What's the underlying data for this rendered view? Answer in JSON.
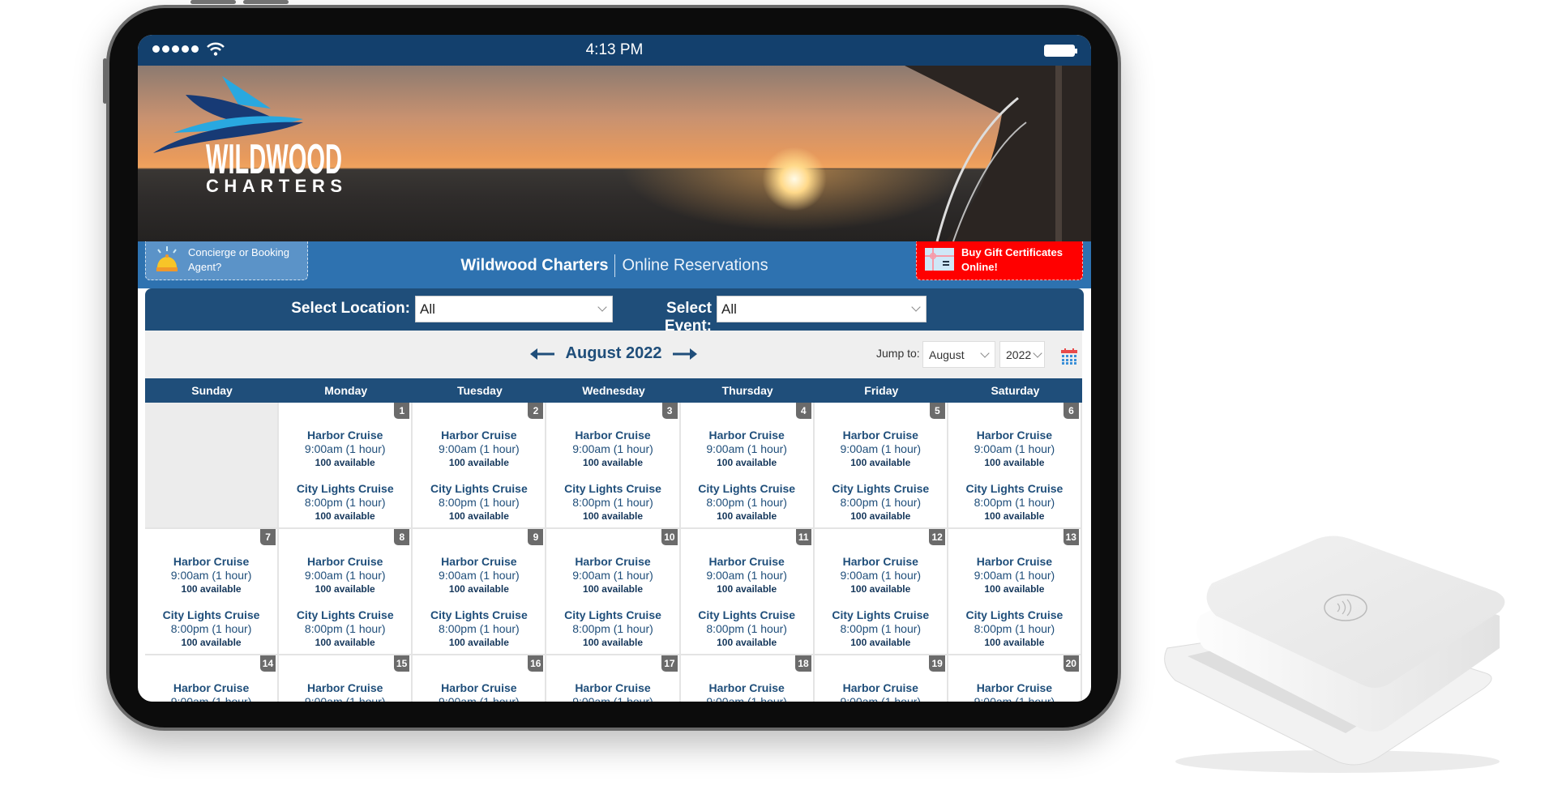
{
  "status_bar": {
    "time": "4:13 PM",
    "signal_icon": "signal-dots-icon",
    "wifi_icon": "wifi-icon",
    "battery_icon": "battery-icon"
  },
  "logo": {
    "line1": "WILDWOOD",
    "line2": "CHARTERS"
  },
  "header": {
    "concierge_label": "Concierge or Booking Agent?",
    "title_bold": "Wildwood Charters",
    "title_light": "Online Reservations",
    "gift_label": "Buy Gift Certificates Online!"
  },
  "filters": {
    "location_label": "Select Location:",
    "location_value": "All",
    "event_label": "Select Event:",
    "event_value": "All"
  },
  "calendar": {
    "month_title": "August 2022",
    "jump_label": "Jump to:",
    "jump_month": "August",
    "jump_year": "2022",
    "weekdays": [
      "Sunday",
      "Monday",
      "Tuesday",
      "Wednesday",
      "Thursday",
      "Friday",
      "Saturday"
    ],
    "weeks": [
      [
        "",
        "1",
        "2",
        "3",
        "4",
        "5",
        "6"
      ],
      [
        "7",
        "8",
        "9",
        "10",
        "11",
        "12",
        "13"
      ],
      [
        "14",
        "15",
        "16",
        "17",
        "18",
        "19",
        "20"
      ]
    ],
    "events": [
      {
        "name": "Harbor Cruise",
        "time": "9:00am (1 hour)",
        "availability": "100 available"
      },
      {
        "name": "City Lights Cruise",
        "time": "8:00pm (1 hour)",
        "availability": "100 available"
      }
    ]
  },
  "colors": {
    "navy": "#1f4e7a",
    "header_blue": "#2e72b0",
    "status_navy": "#13406d",
    "gift_red": "#ff0000",
    "date_badge": "#6b6b6b"
  }
}
